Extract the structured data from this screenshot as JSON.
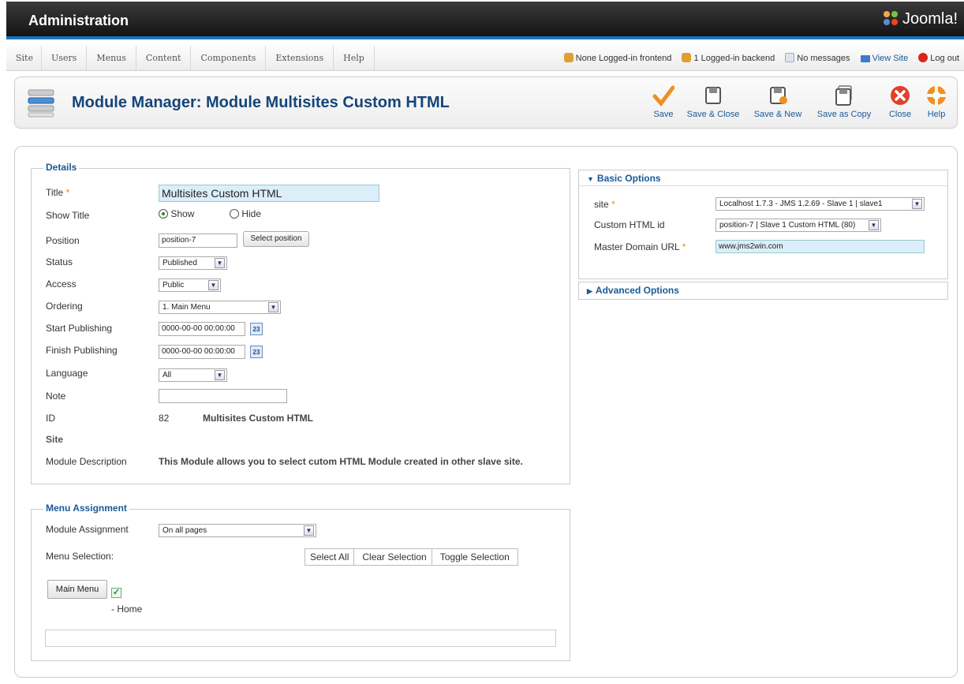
{
  "header": {
    "title": "Administration",
    "logo_text": "Joomla!"
  },
  "menu": {
    "items": [
      "Site",
      "Users",
      "Menus",
      "Content",
      "Components",
      "Extensions",
      "Help"
    ]
  },
  "status": {
    "frontend": "None Logged-in frontend",
    "backend": "1 Logged-in backend",
    "messages": "No messages",
    "view_site": "View Site",
    "logout": "Log out"
  },
  "toolbar": {
    "page_title": "Module Manager: Module Multisites Custom HTML",
    "buttons": [
      "Save",
      "Save & Close",
      "Save & New",
      "Save as Copy",
      "Close",
      "Help"
    ]
  },
  "details": {
    "legend": "Details",
    "labels": {
      "title": "Title",
      "show_title": "Show Title",
      "position": "Position",
      "status": "Status",
      "access": "Access",
      "ordering": "Ordering",
      "start_publishing": "Start Publishing",
      "finish_publishing": "Finish Publishing",
      "language": "Language",
      "note": "Note",
      "id": "ID",
      "site": "Site",
      "module_description": "Module Description"
    },
    "required_mark": "*",
    "values": {
      "title": "Multisites Custom HTML",
      "show": "Show",
      "hide": "Hide",
      "position": "position-7",
      "select_position": "Select position",
      "status": "Published",
      "access": "Public",
      "ordering": "1. Main Menu",
      "start_publishing": "0000-00-00 00:00:00",
      "finish_publishing": "0000-00-00 00:00:00",
      "calendar_day": "23",
      "language": "All",
      "note": "",
      "id": "82",
      "id_name": "Multisites Custom HTML",
      "module_description": "This Module allows you to select cutom HTML Module created in other slave site."
    }
  },
  "menu_assignment": {
    "legend": "Menu Assignment",
    "module_assignment_label": "Module Assignment",
    "module_assignment": "On all pages",
    "menu_selection_label": "Menu Selection:",
    "buttons": [
      "Select All",
      "Clear Selection",
      "Toggle Selection"
    ],
    "main_menu": "Main Menu",
    "home": "- Home"
  },
  "basic_options": {
    "header": "Basic Options",
    "site_label": "site",
    "site_value": "Localhost 1.7.3 - JMS 1.2.69 - Slave 1 | slave1",
    "custom_html_label": "Custom HTML id",
    "custom_html_value": "position-7 | Slave 1 Custom HTML (80)",
    "master_domain_label": "Master Domain URL",
    "master_domain_value": "www.jms2win.com"
  },
  "advanced_options": {
    "header": "Advanced Options"
  },
  "colors": {
    "accent": "#1a5a96",
    "title": "#15457a",
    "header_bar": "#1a74b8",
    "required": "#f28a1a"
  }
}
